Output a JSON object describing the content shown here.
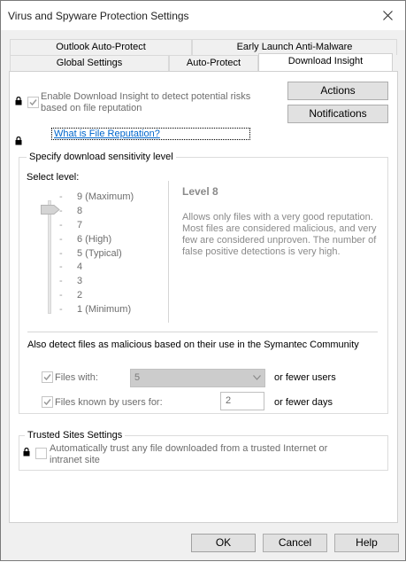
{
  "window": {
    "title": "Virus and Spyware Protection Settings"
  },
  "tabs": {
    "row1": [
      {
        "label": "Outlook Auto-Protect"
      },
      {
        "label": "Early Launch Anti-Malware"
      }
    ],
    "row2": [
      {
        "label": "Global Settings"
      },
      {
        "label": "Auto-Protect"
      },
      {
        "label": "Download Insight",
        "active": true
      }
    ]
  },
  "download_insight": {
    "enable_line1": "Enable Download Insight to detect potential risks",
    "enable_line2": "based on file reputation",
    "enable_checked": true,
    "reputation_link": "What is File Reputation?",
    "actions_button": "Actions",
    "notifications_button": "Notifications"
  },
  "sensitivity": {
    "group_title": "Specify download sensitivity level",
    "select_label": "Select level:",
    "levels": [
      "9 (Maximum)",
      "8",
      "7",
      "6 (High)",
      "5 (Typical)",
      "4",
      "3",
      "2",
      "1 (Minimum)"
    ],
    "selected_level": 8,
    "level_title": "Level 8",
    "level_description": "Allows only files with a very good reputation. Most files are considered malicious, and very few are considered unproven. The number of false positive detections is very high."
  },
  "community": {
    "heading": "Also detect files as malicious based on their use in the Symantec Community",
    "files_with_label": "Files with:",
    "files_with_checked": true,
    "files_with_value": "5",
    "fewer_users_label": "or fewer users",
    "known_by_label": "Files known by users for:",
    "known_by_checked": true,
    "known_by_value": "2",
    "fewer_days_label": "or fewer days"
  },
  "trusted_sites": {
    "group_title": "Trusted Sites Settings",
    "line1": "Automatically trust any file downloaded from a trusted Internet or",
    "line2": "intranet site",
    "checked": false
  },
  "footer": {
    "ok_button": "OK",
    "cancel_button": "Cancel",
    "help_button": "Help"
  },
  "icons": {
    "close": "close-icon",
    "lock": "lock-icon",
    "check": "checkmark-icon",
    "dropdown": "chevron-down-icon"
  },
  "colors": {
    "link": "#0066cc",
    "disabled_text": "#6d6d6d",
    "button_face": "#e1e1e1",
    "combo_disabled": "#cccccc"
  }
}
